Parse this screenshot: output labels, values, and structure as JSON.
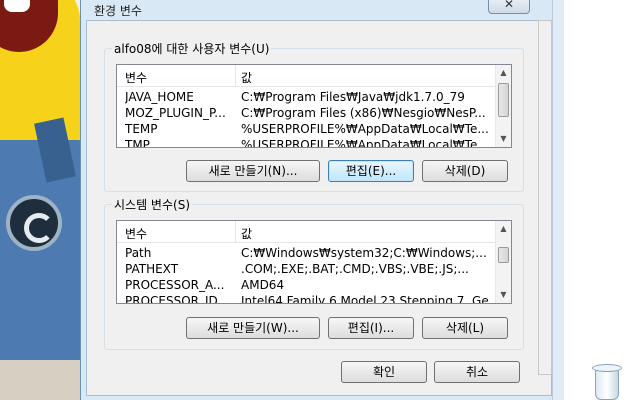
{
  "window": {
    "title": "환경 변수",
    "close_glyph": "✕"
  },
  "user_vars": {
    "group_label": "alfo08에 대한 사용자 변수(U)",
    "columns": [
      "변수",
      "값"
    ],
    "rows": [
      {
        "name": "JAVA_HOME",
        "value": "C:₩Program Files₩Java₩jdk1.7.0_79"
      },
      {
        "name": "MOZ_PLUGIN_P...",
        "value": "C:₩Program Files (x86)₩Nesgio₩NesP..."
      },
      {
        "name": "TEMP",
        "value": "%USERPROFILE%₩AppData₩Local₩Te..."
      },
      {
        "name": "TMP",
        "value": "%USERPROFILE%₩AppData₩Local₩Te..."
      }
    ],
    "buttons": {
      "new": "새로 만들기(N)...",
      "edit": "편집(E)...",
      "delete": "삭제(D)"
    }
  },
  "system_vars": {
    "group_label": "시스템 변수(S)",
    "columns": [
      "변수",
      "값"
    ],
    "rows": [
      {
        "name": "Path",
        "value": "C:₩Windows₩system32;C:₩Windows;..."
      },
      {
        "name": "PATHEXT",
        "value": ".COM;.EXE;.BAT;.CMD;.VBS;.VBE;.JS;..."
      },
      {
        "name": "PROCESSOR_A...",
        "value": "AMD64"
      },
      {
        "name": "PROCESSOR_ID...",
        "value": "Intel64 Family 6 Model 23 Stepping 7, Ge..."
      }
    ],
    "buttons": {
      "new": "새로 만들기(W)...",
      "edit": "편집(I)...",
      "delete": "삭제(L)"
    }
  },
  "footer": {
    "ok": "확인",
    "cancel": "취소"
  },
  "desktop": {
    "recycle_bin_icon": "recycle-bin-icon"
  }
}
